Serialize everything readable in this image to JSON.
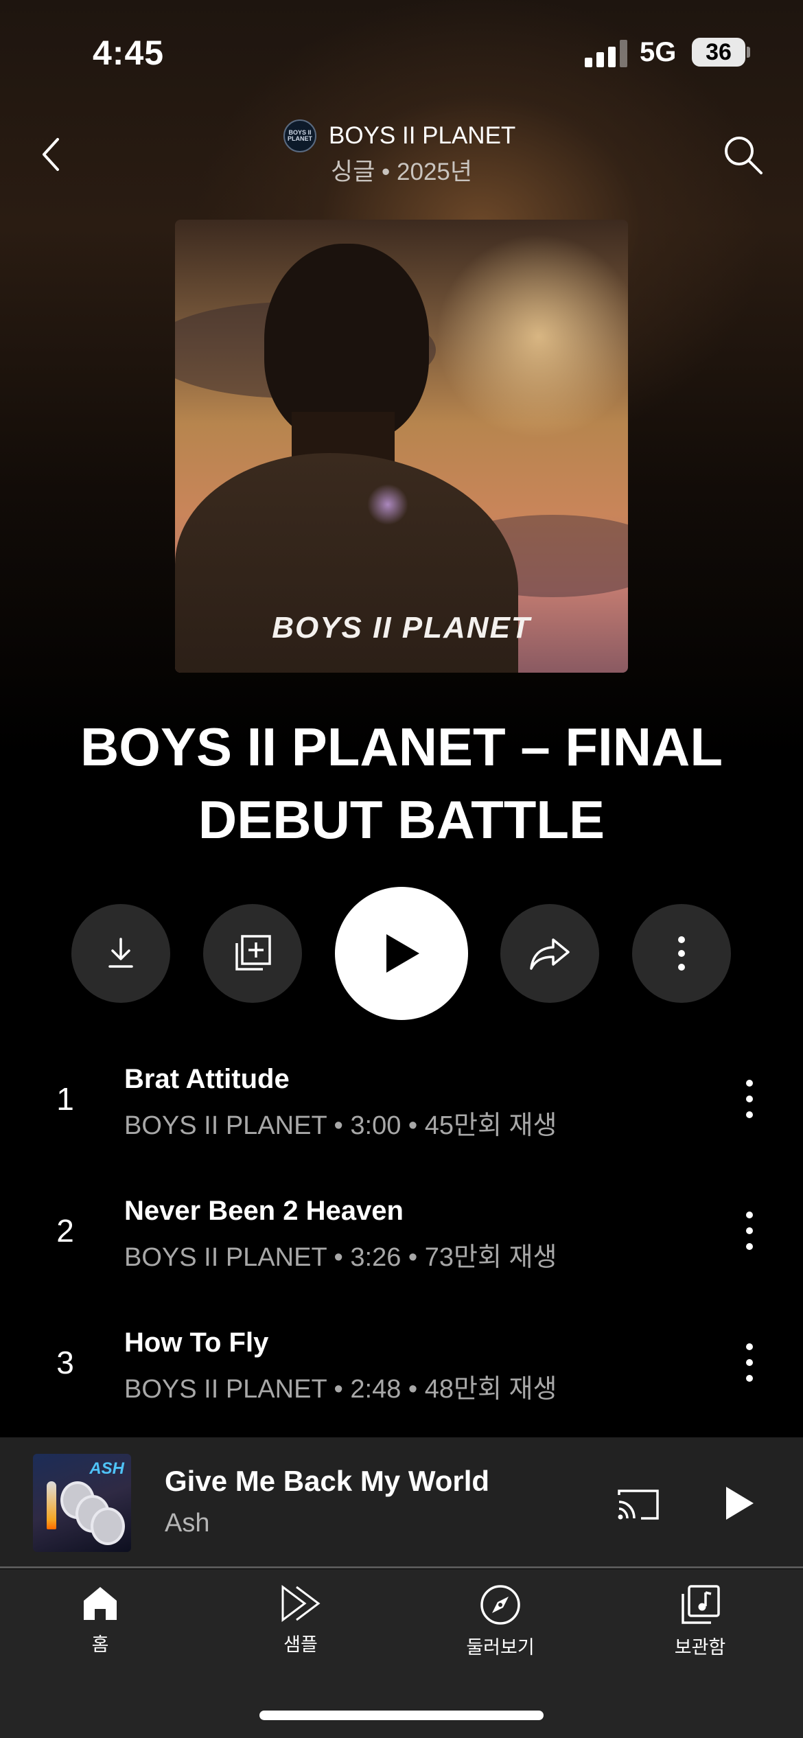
{
  "status_bar": {
    "time": "4:45",
    "network": "5G",
    "battery": "36"
  },
  "header": {
    "artist": "BOYS II PLANET",
    "subtitle": "싱글 • 2025년",
    "avatar_text": "BOYS II PLANET"
  },
  "album": {
    "art_logo": "BOYS II PLANET",
    "title": "BOYS II PLANET – FINAL DEBUT BATTLE"
  },
  "actions": [
    "download",
    "add-to-playlist",
    "play",
    "share",
    "more"
  ],
  "tracks": [
    {
      "number": "1",
      "name": "Brat Attitude",
      "meta": "BOYS II PLANET • 3:00 • 45만회 재생"
    },
    {
      "number": "2",
      "name": "Never Been 2 Heaven",
      "meta": "BOYS II PLANET • 3:26 • 73만회 재생"
    },
    {
      "number": "3",
      "name": "How To Fly",
      "meta": "BOYS II PLANET • 2:48 • 48만회 재생"
    }
  ],
  "mini_player": {
    "title": "Give Me Back My World",
    "artist": "Ash",
    "thumb_label": "ASH",
    "progress": 0.0
  },
  "tabs": [
    {
      "label": "홈",
      "icon": "home-icon",
      "active": true
    },
    {
      "label": "샘플",
      "icon": "samples-icon",
      "active": false
    },
    {
      "label": "둘러보기",
      "icon": "explore-icon",
      "active": false
    },
    {
      "label": "보관함",
      "icon": "library-icon",
      "active": false
    }
  ],
  "colors": {
    "background": "#000000",
    "mini_player_bg": "#222222",
    "tab_bar_bg": "#252525",
    "muted_text": "#a8a8a8"
  }
}
